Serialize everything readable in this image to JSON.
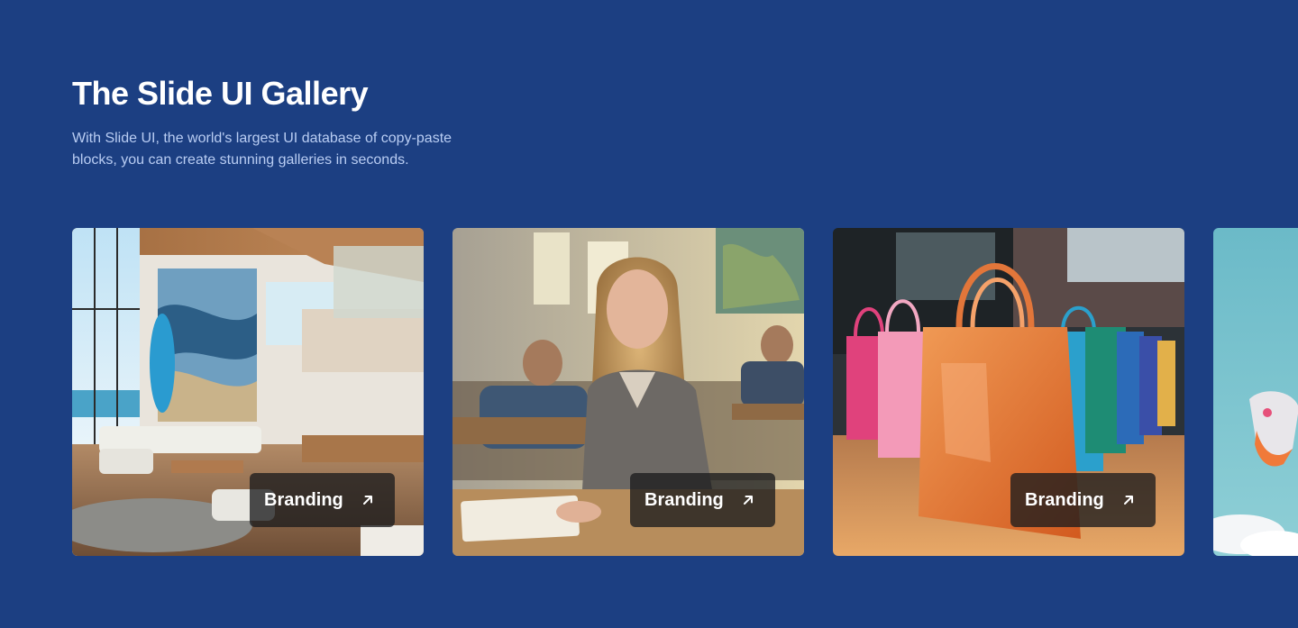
{
  "header": {
    "title": "The Slide UI Gallery",
    "subtitle": "With Slide UI, the world's largest UI database of copy-paste blocks, you can create stunning galleries in seconds."
  },
  "gallery": {
    "cards": [
      {
        "image": "beach-house-living-room",
        "label": "Branding",
        "icon": "arrow-up-right-icon"
      },
      {
        "image": "student-in-classroom",
        "label": "Branding",
        "icon": "arrow-up-right-icon"
      },
      {
        "image": "colorful-shopping-bags",
        "label": "Branding",
        "icon": "arrow-up-right-icon"
      },
      {
        "image": "sneaker-in-sky"
      }
    ]
  },
  "colors": {
    "background": "#1c3f82",
    "title": "#ffffff",
    "subtitle": "#b9cdf3",
    "badge": "#1c1c1e"
  }
}
